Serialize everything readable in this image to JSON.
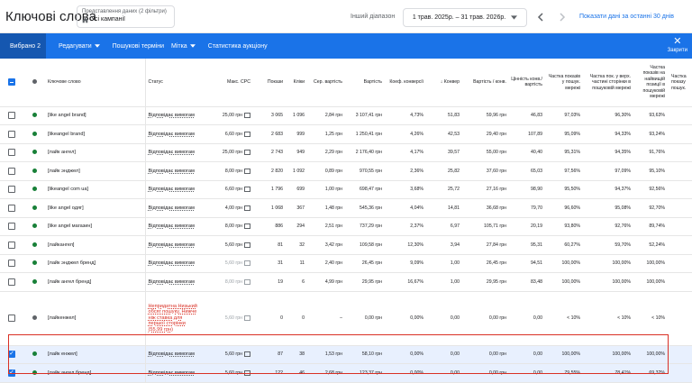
{
  "header": {
    "title": "Ключові слова",
    "view_label": "Представлення даних (2 фільтри)",
    "view_value": "Усі кампанії",
    "other_range": "Інший діапазон",
    "date_range": "1 трав. 2025р. – 31 трав. 2026р.",
    "show_last": "Показати дані за останні 30 днів"
  },
  "toolbar": {
    "selected": "Вибрано 2",
    "edit": "Редагувати",
    "search_terms": "Пошукові терміни",
    "label": "Мітка",
    "auction": "Статистика аукціону",
    "close": "Закрити"
  },
  "columns": {
    "keyword": "Ключове слово",
    "status": "Статус",
    "max_cpc": "Макс. CPC",
    "impr": "Покази",
    "clicks": "Кліки",
    "avg_cost": "Сер. вартість",
    "cost": "Вартість",
    "conv_rate": "Коеф. конверсії",
    "conv": "Конвер",
    "cost_conv": "Вартість / конв.",
    "value_cost": "Цінність конв./ вартість",
    "search_is": "Частка показів у пошук. мережі",
    "top_is": "Частка пок. у верх. частині сторінки в пошуковій мережі",
    "abs_top_is": "Частка показів на найвищій позиції в пошуковій мережі",
    "last": "Частка показу пошук."
  },
  "sort_arrow": "↓",
  "rows": [
    {
      "kw": "[like angel brand]",
      "status": "Відповідає вимогам",
      "cpc": "25,00 грн",
      "impr": "3 065",
      "clicks": "1 096",
      "avg": "2,84 грн",
      "cost": "3 107,41 грн",
      "cr": "4,73%",
      "conv": "51,83",
      "cc": "59,96 грн",
      "vc": "46,83",
      "sis": "97,03%",
      "tis": "96,30%",
      "atis": "93,63%"
    },
    {
      "kw": "[likeangel brand]",
      "status": "Відповідає вимогам",
      "cpc": "6,60 грн",
      "impr": "2 683",
      "clicks": "999",
      "avg": "1,25 грн",
      "cost": "1 250,41 грн",
      "cr": "4,26%",
      "conv": "42,53",
      "cc": "29,40 грн",
      "vc": "107,89",
      "sis": "95,09%",
      "tis": "94,33%",
      "atis": "93,24%"
    },
    {
      "kw": "[лайк ангел]",
      "status": "Відповідає вимогам",
      "cpc": "25,00 грн",
      "impr": "2 743",
      "clicks": "949",
      "avg": "2,29 грн",
      "cost": "2 176,40 грн",
      "cr": "4,17%",
      "conv": "39,57",
      "cc": "55,00 грн",
      "vc": "40,40",
      "sis": "95,31%",
      "tis": "94,35%",
      "atis": "91,76%"
    },
    {
      "kw": "[лайк энджел]",
      "status": "Відповідає вимогам",
      "cpc": "8,00 грн",
      "impr": "2 820",
      "clicks": "1 092",
      "avg": "0,89 грн",
      "cost": "970,55 грн",
      "cr": "2,36%",
      "conv": "25,82",
      "cc": "37,60 грн",
      "vc": "65,03",
      "sis": "97,56%",
      "tis": "97,09%",
      "atis": "95,10%"
    },
    {
      "kw": "[likeangel com ua]",
      "status": "Відповідає вимогам",
      "cpc": "6,60 грн",
      "impr": "1 796",
      "clicks": "699",
      "avg": "1,00 грн",
      "cost": "698,47 грн",
      "cr": "3,68%",
      "conv": "25,72",
      "cc": "27,16 грн",
      "vc": "98,90",
      "sis": "95,50%",
      "tis": "94,37%",
      "atis": "92,56%"
    },
    {
      "kw": "[like angel одяг]",
      "status": "Відповідає вимогам",
      "cpc": "4,00 грн",
      "impr": "1 068",
      "clicks": "367",
      "avg": "1,48 грн",
      "cost": "545,36 грн",
      "cr": "4,04%",
      "conv": "14,81",
      "cc": "36,68 грн",
      "vc": "79,70",
      "sis": "96,60%",
      "tis": "95,08%",
      "atis": "92,70%"
    },
    {
      "kw": "[like angel магазин]",
      "status": "Відповідає вимогам",
      "cpc": "8,00 грн",
      "impr": "886",
      "clicks": "294",
      "avg": "2,51 грн",
      "cost": "737,29 грн",
      "cr": "2,37%",
      "conv": "6,97",
      "cc": "105,71 грн",
      "vc": "20,19",
      "sis": "93,80%",
      "tis": "92,76%",
      "atis": "89,74%"
    },
    {
      "kw": "[лайкангел]",
      "status": "Відповідає вимогам",
      "cpc": "5,60 грн",
      "impr": "81",
      "clicks": "32",
      "avg": "3,42 грн",
      "cost": "109,58 грн",
      "cr": "12,30%",
      "conv": "3,94",
      "cc": "27,84 грн",
      "vc": "95,31",
      "sis": "60,27%",
      "tis": "59,70%",
      "atis": "52,24%"
    },
    {
      "kw": "[лайк энджел бренд]",
      "status": "Відповідає вимогам",
      "cpc": "5,60 грн",
      "dim": true,
      "impr": "31",
      "clicks": "11",
      "avg": "2,40 грн",
      "cost": "26,45 грн",
      "cr": "9,09%",
      "conv": "1,00",
      "cc": "26,45 грн",
      "vc": "94,51",
      "sis": "100,00%",
      "tis": "100,00%",
      "atis": "100,00%"
    },
    {
      "kw": "[лайк ангел бренд]",
      "status": "Відповідає вимогам",
      "cpc": "8,00 грн",
      "dim": true,
      "impr": "19",
      "clicks": "6",
      "avg": "4,99 грн",
      "cost": "29,95 грн",
      "cr": "16,67%",
      "conv": "1,00",
      "cc": "29,95 грн",
      "vc": "83,48",
      "sis": "100,00%",
      "tis": "100,00%",
      "atis": "100,00%"
    },
    {
      "kw": "[лайкенжел]",
      "status": "Непридатна Низький обсяг пошуку, Нижче ніж ставка для першої сторінки (55,99 грн)",
      "red": true,
      "grey": true,
      "cpc": "5,60 грн",
      "dim": true,
      "impr": "0",
      "clicks": "0",
      "avg": "–",
      "cost": "0,00 грн",
      "cr": "0,00%",
      "conv": "0,00",
      "cc": "0,00 грн",
      "vc": "0,00",
      "sis": "< 10%",
      "tis": "< 10%",
      "atis": "< 10%"
    },
    {
      "kw": "[лайк енжел]",
      "status": "Відповідає вимогам",
      "cpc": "5,60 грн",
      "sel": true,
      "impr": "87",
      "clicks": "38",
      "avg": "1,53 грн",
      "cost": "58,10 грн",
      "cr": "0,00%",
      "conv": "0,00",
      "cc": "0,00 грн",
      "vc": "0,00",
      "sis": "100,00%",
      "tis": "100,00%",
      "atis": "100,00%"
    },
    {
      "kw": "[лайк ангел бренд]",
      "status": "Відповідає вимогам",
      "cpc": "5,60 грн",
      "sel": true,
      "impr": "122",
      "clicks": "46",
      "avg": "2,68 грн",
      "cost": "123,37 грн",
      "cr": "0,00%",
      "conv": "0,00",
      "cc": "0,00 грн",
      "vc": "0,00",
      "sis": "79,55%",
      "tis": "78,41%",
      "atis": "69,32%"
    }
  ]
}
